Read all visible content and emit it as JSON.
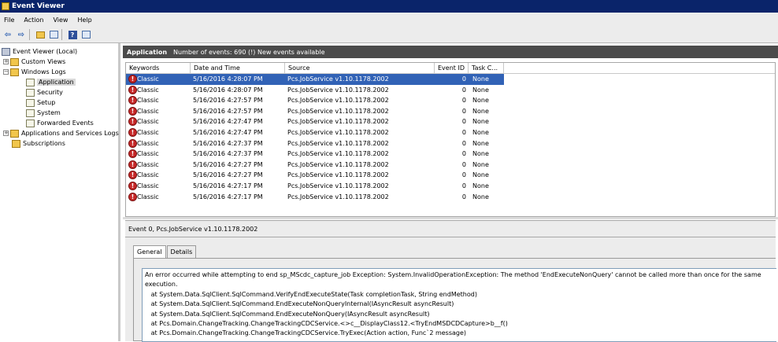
{
  "window": {
    "title": "Event Viewer"
  },
  "menu": [
    {
      "label": "File"
    },
    {
      "label": "Action"
    },
    {
      "label": "View"
    },
    {
      "label": "Help"
    }
  ],
  "toolbar": {
    "buttons": [
      "back-icon",
      "forward-icon",
      "up-folder-icon",
      "properties-icon",
      "help-icon",
      "console-tree-icon"
    ]
  },
  "tree": {
    "root": "Event Viewer (Local)",
    "custom_views": "Custom Views",
    "windows_logs": "Windows Logs",
    "logs": [
      "Application",
      "Security",
      "Setup",
      "System",
      "Forwarded Events"
    ],
    "apps_services": "Applications and Services Logs",
    "subscriptions": "Subscriptions",
    "selected": "Application"
  },
  "header": {
    "log_name": "Application",
    "summary": "Number of events: 690 (!) New events available"
  },
  "columns": [
    "Keywords",
    "Date and Time",
    "Source",
    "Event ID",
    "Task C..."
  ],
  "events": [
    {
      "keywords": "Classic",
      "datetime": "5/16/2016 4:28:07 PM",
      "source": "Pcs.JobService v1.10.1178.2002",
      "event_id": "0",
      "task": "None"
    },
    {
      "keywords": "Classic",
      "datetime": "5/16/2016 4:28:07 PM",
      "source": "Pcs.JobService v1.10.1178.2002",
      "event_id": "0",
      "task": "None"
    },
    {
      "keywords": "Classic",
      "datetime": "5/16/2016 4:27:57 PM",
      "source": "Pcs.JobService v1.10.1178.2002",
      "event_id": "0",
      "task": "None"
    },
    {
      "keywords": "Classic",
      "datetime": "5/16/2016 4:27:57 PM",
      "source": "Pcs.JobService v1.10.1178.2002",
      "event_id": "0",
      "task": "None"
    },
    {
      "keywords": "Classic",
      "datetime": "5/16/2016 4:27:47 PM",
      "source": "Pcs.JobService v1.10.1178.2002",
      "event_id": "0",
      "task": "None"
    },
    {
      "keywords": "Classic",
      "datetime": "5/16/2016 4:27:47 PM",
      "source": "Pcs.JobService v1.10.1178.2002",
      "event_id": "0",
      "task": "None"
    },
    {
      "keywords": "Classic",
      "datetime": "5/16/2016 4:27:37 PM",
      "source": "Pcs.JobService v1.10.1178.2002",
      "event_id": "0",
      "task": "None"
    },
    {
      "keywords": "Classic",
      "datetime": "5/16/2016 4:27:37 PM",
      "source": "Pcs.JobService v1.10.1178.2002",
      "event_id": "0",
      "task": "None"
    },
    {
      "keywords": "Classic",
      "datetime": "5/16/2016 4:27:27 PM",
      "source": "Pcs.JobService v1.10.1178.2002",
      "event_id": "0",
      "task": "None"
    },
    {
      "keywords": "Classic",
      "datetime": "5/16/2016 4:27:27 PM",
      "source": "Pcs.JobService v1.10.1178.2002",
      "event_id": "0",
      "task": "None"
    },
    {
      "keywords": "Classic",
      "datetime": "5/16/2016 4:27:17 PM",
      "source": "Pcs.JobService v1.10.1178.2002",
      "event_id": "0",
      "task": "None"
    },
    {
      "keywords": "Classic",
      "datetime": "5/16/2016 4:27:17 PM",
      "source": "Pcs.JobService v1.10.1178.2002",
      "event_id": "0",
      "task": "None"
    }
  ],
  "selected_row": 0,
  "detail": {
    "title": "Event 0, Pcs.JobService v1.10.1178.2002",
    "tabs": [
      "General",
      "Details"
    ],
    "active_tab": "General",
    "message": "An error occurred while attempting to end sp_MScdc_capture_job Exception: System.InvalidOperationException: The method 'EndExecuteNonQuery' cannot be called more than once for the same execution.\n   at System.Data.SqlClient.SqlCommand.VerifyEndExecuteState(Task completionTask, String endMethod)\n   at System.Data.SqlClient.SqlCommand.EndExecuteNonQueryInternal(IAsyncResult asyncResult)\n   at System.Data.SqlClient.SqlCommand.EndExecuteNonQuery(IAsyncResult asyncResult)\n   at Pcs.Domain.ChangeTracking.ChangeTrackingCDCService.<>c__DisplayClass12.<TryEndMSDCDCapture>b__f()\n   at Pcs.Domain.ChangeTracking.ChangeTrackingCDCService.TryExec(Action action, Func`2 message)"
  },
  "colors": {
    "title_bar": "#0a246a",
    "selection": "#3162b6",
    "pane_header": "#4b4b4b",
    "error_icon": "#c62828"
  }
}
